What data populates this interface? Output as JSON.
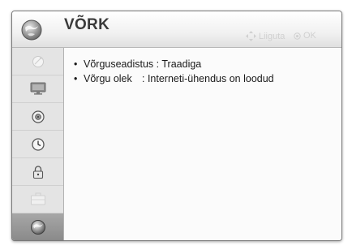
{
  "header": {
    "title": "VÕRK",
    "hint_move_label": "Liiguta",
    "hint_ok_label": "OK",
    "icon": "network-globe-icon"
  },
  "sidebar": {
    "items": [
      {
        "name": "satellite-dish-icon",
        "active": false
      },
      {
        "name": "monitor-icon",
        "active": false
      },
      {
        "name": "speaker-icon",
        "active": false
      },
      {
        "name": "clock-icon",
        "active": false
      },
      {
        "name": "lock-icon",
        "active": false
      },
      {
        "name": "briefcase-icon",
        "active": false
      },
      {
        "name": "network-globe-icon",
        "active": true
      }
    ]
  },
  "content": {
    "rows": [
      {
        "label": "Võrguseadistus",
        "value": ": Traadiga"
      },
      {
        "label": "Võrgu olek",
        "value": ": Interneti-ühendus on loodud"
      }
    ]
  },
  "colors": {
    "active_sidebar": "#9a9a9a",
    "sidebar_bg": "#e4e4e4",
    "header_text": "#3a3a3a",
    "hint_text": "#d0d0d0"
  }
}
